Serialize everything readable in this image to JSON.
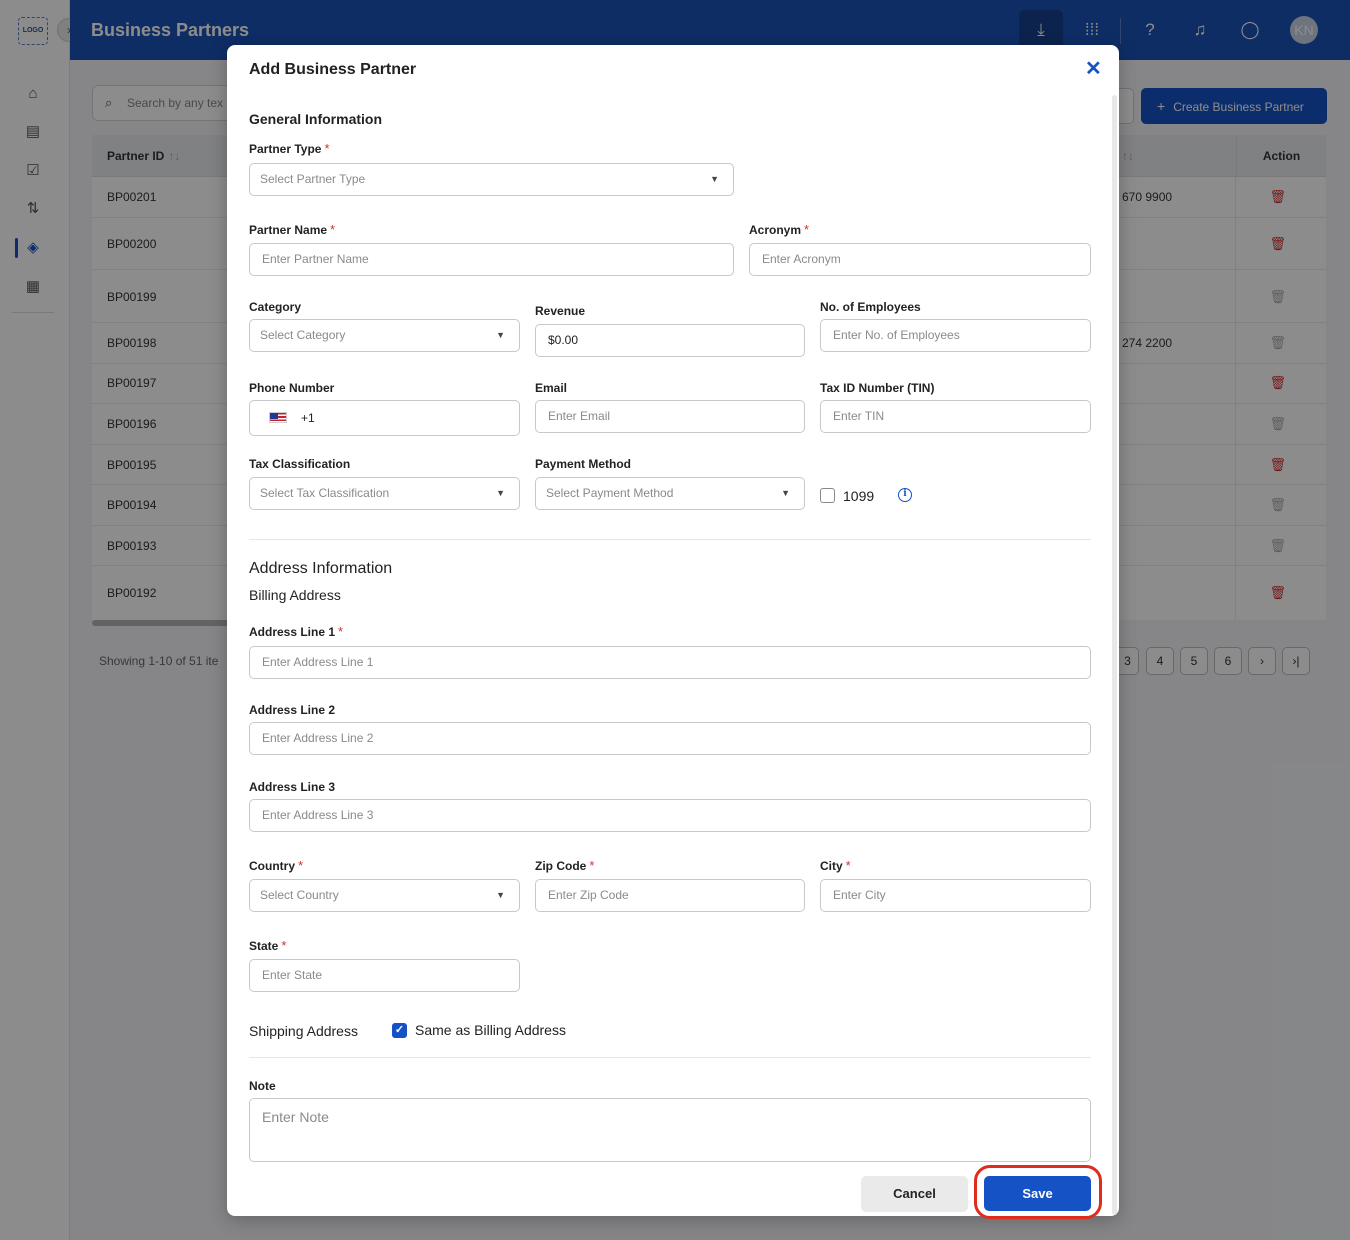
{
  "app": {
    "logo_text": "LOGO",
    "page_title": "Business Partners",
    "avatar_initials": "KN",
    "search_placeholder": "Search by any tex",
    "create_button": "Create Business Partner"
  },
  "table": {
    "columns": {
      "partner_id": "Partner ID",
      "action": "Action"
    },
    "rows": [
      {
        "id": "BP00201",
        "phone": "670 9900",
        "delete_active": true
      },
      {
        "id": "BP00200",
        "phone": "",
        "delete_active": true
      },
      {
        "id": "BP00199",
        "phone": "",
        "delete_active": false
      },
      {
        "id": "BP00198",
        "phone": "274 2200",
        "delete_active": false
      },
      {
        "id": "BP00197",
        "phone": "",
        "delete_active": true
      },
      {
        "id": "BP00196",
        "phone": "",
        "delete_active": false
      },
      {
        "id": "BP00195",
        "phone": "",
        "delete_active": true
      },
      {
        "id": "BP00194",
        "phone": "",
        "delete_active": false
      },
      {
        "id": "BP00193",
        "phone": "",
        "delete_active": false
      },
      {
        "id": "BP00192",
        "phone": "",
        "delete_active": true
      }
    ],
    "showing_text": "Showing 1-10 of 51 ite",
    "pages": [
      "3",
      "4",
      "5",
      "6"
    ]
  },
  "modal": {
    "title": "Add Business Partner",
    "general_section": "General Information",
    "fields": {
      "partner_type": {
        "label": "Partner Type",
        "placeholder": "Select Partner Type"
      },
      "partner_name": {
        "label": "Partner Name",
        "placeholder": "Enter Partner Name"
      },
      "acronym": {
        "label": "Acronym",
        "placeholder": "Enter Acronym"
      },
      "category": {
        "label": "Category",
        "placeholder": "Select Category"
      },
      "revenue": {
        "label": "Revenue",
        "value": "$0.00"
      },
      "employees": {
        "label": "No. of Employees",
        "placeholder": "Enter No. of Employees"
      },
      "phone": {
        "label": "Phone Number",
        "value": "+1"
      },
      "email": {
        "label": "Email",
        "placeholder": "Enter Email"
      },
      "tin": {
        "label": "Tax ID Number (TIN)",
        "placeholder": "Enter TIN"
      },
      "tax_class": {
        "label": "Tax Classification",
        "placeholder": "Select Tax Classification"
      },
      "payment": {
        "label": "Payment Method",
        "placeholder": "Select Payment Method"
      },
      "form1099": {
        "label": "1099",
        "checked": false
      },
      "addr1": {
        "label": "Address Line 1",
        "placeholder": "Enter Address Line 1"
      },
      "addr2": {
        "label": "Address Line 2",
        "placeholder": "Enter Address Line 2"
      },
      "addr3": {
        "label": "Address Line 3",
        "placeholder": "Enter Address Line 3"
      },
      "country": {
        "label": "Country",
        "placeholder": "Select Country"
      },
      "zip": {
        "label": "Zip Code",
        "placeholder": "Enter Zip Code"
      },
      "city": {
        "label": "City",
        "placeholder": "Enter City"
      },
      "state": {
        "label": "State",
        "placeholder": "Enter State"
      },
      "note": {
        "label": "Note",
        "placeholder": "Enter Note"
      }
    },
    "address_section": "Address Information",
    "billing_section": "Billing Address",
    "shipping_label": "Shipping Address",
    "same_as_billing": {
      "label": "Same as Billing Address",
      "checked": true
    },
    "cancel_button": "Cancel",
    "save_button": "Save"
  },
  "colors": {
    "primary": "#1452c5",
    "header": "#1b53b8",
    "required": "#d32f2f",
    "highlight": "#e02b1f",
    "delete": "#d32f2f"
  }
}
